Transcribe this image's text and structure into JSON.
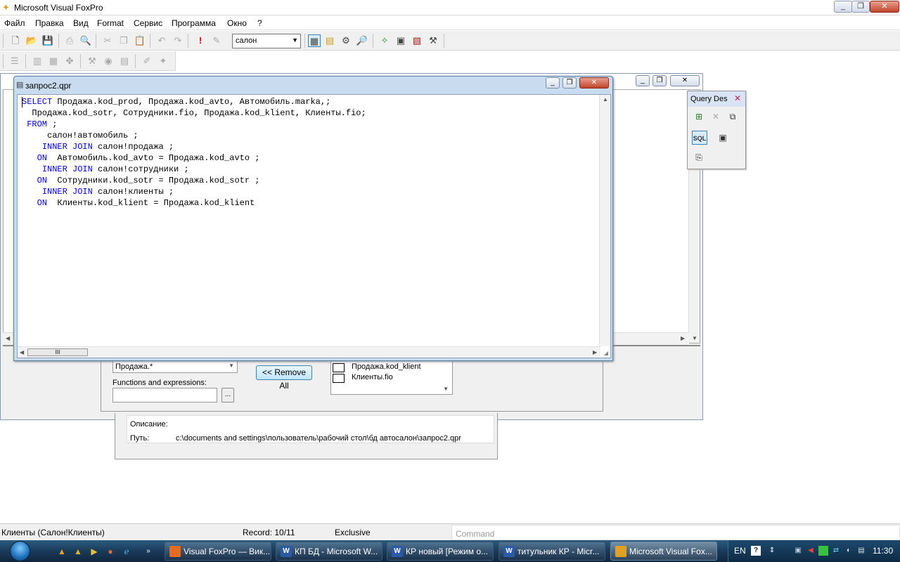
{
  "app": {
    "title": "Microsoft Visual FoxPro"
  },
  "menu": [
    "Файл",
    "Правка",
    "Вид",
    "Format",
    "Сервис",
    "Программа",
    "Окно",
    "?"
  ],
  "toolbar": {
    "database_combo": "салон"
  },
  "sql_window": {
    "title": "запрос2.qpr",
    "code_lines": [
      [
        {
          "t": "SELECT",
          "k": true
        },
        {
          "t": " Продажа.kod_prod, Продажа.kod_avto, Автомобиль.marka,;"
        }
      ],
      [
        {
          "t": "  Продажа.kod_sotr, Сотрудники.fio, Продажа.kod_klient, Клиенты.fio;"
        }
      ],
      [
        {
          "t": " "
        },
        {
          "t": "FROM",
          "k": true
        },
        {
          "t": " ;"
        }
      ],
      [
        {
          "t": "     салон!автомобиль ;"
        }
      ],
      [
        {
          "t": "    "
        },
        {
          "t": "INNER JOIN",
          "k": true
        },
        {
          "t": " салон!продажа ;"
        }
      ],
      [
        {
          "t": "   "
        },
        {
          "t": "ON",
          "k": true
        },
        {
          "t": "  Автомобиль.kod_avto = Продажа.kod_avto ;"
        }
      ],
      [
        {
          "t": "    "
        },
        {
          "t": "INNER JOIN",
          "k": true
        },
        {
          "t": " салон!сотрудники ;"
        }
      ],
      [
        {
          "t": "   "
        },
        {
          "t": "ON",
          "k": true
        },
        {
          "t": "  Сотрудники.kod_sotr = Продажа.kod_sotr ;"
        }
      ],
      [
        {
          "t": "    "
        },
        {
          "t": "INNER JOIN",
          "k": true
        },
        {
          "t": " салон!клиенты ;"
        }
      ],
      [
        {
          "t": "   "
        },
        {
          "t": "ON",
          "k": true
        },
        {
          "t": "  Клиенты.kod_klient = Продажа.kod_klient"
        }
      ]
    ],
    "scroll_thumb_glyph": "III"
  },
  "query_designer_palette": {
    "title": "Query Des",
    "sql_label": "SQL"
  },
  "fields_panel": {
    "table_combo": "Продажа.*",
    "functions_label": "Functions and expressions:",
    "browse_button": "...",
    "remove_all_button": "<< Remove All",
    "selected_fields": [
      "Продажа.kod_klient",
      "Клиенты.fio"
    ]
  },
  "info_panel": {
    "description_label": "Описание:",
    "path_label": "Путь:",
    "path_value": "c:\\documents and settings\\пользователь\\рабочий стол\\бд автосалон\\запрос2.qpr"
  },
  "status": {
    "table": "Клиенты (Салон!Клиенты)",
    "record": "Record: 10/11",
    "mode": "Exclusive",
    "command_placeholder": "Command"
  },
  "taskbar": {
    "items": [
      {
        "label": "Visual FoxPro — Вик...",
        "icon": "firefox-icon",
        "color": "#e86a1e"
      },
      {
        "label": "КП БД - Microsoft W...",
        "icon": "word-icon",
        "color": "#2a5aa8"
      },
      {
        "label": "КР новый [Режим о...",
        "icon": "word-icon",
        "color": "#2a5aa8"
      },
      {
        "label": "титульник КР - Micr...",
        "icon": "word-icon",
        "color": "#2a5aa8"
      },
      {
        "label": "Microsoft Visual Fox...",
        "icon": "foxpro-icon",
        "color": "#e0a020"
      }
    ],
    "lang": "EN",
    "clock": "11:30"
  },
  "colors": {
    "keyword": "#0000cc",
    "taskbar": "#1a3a5a"
  }
}
